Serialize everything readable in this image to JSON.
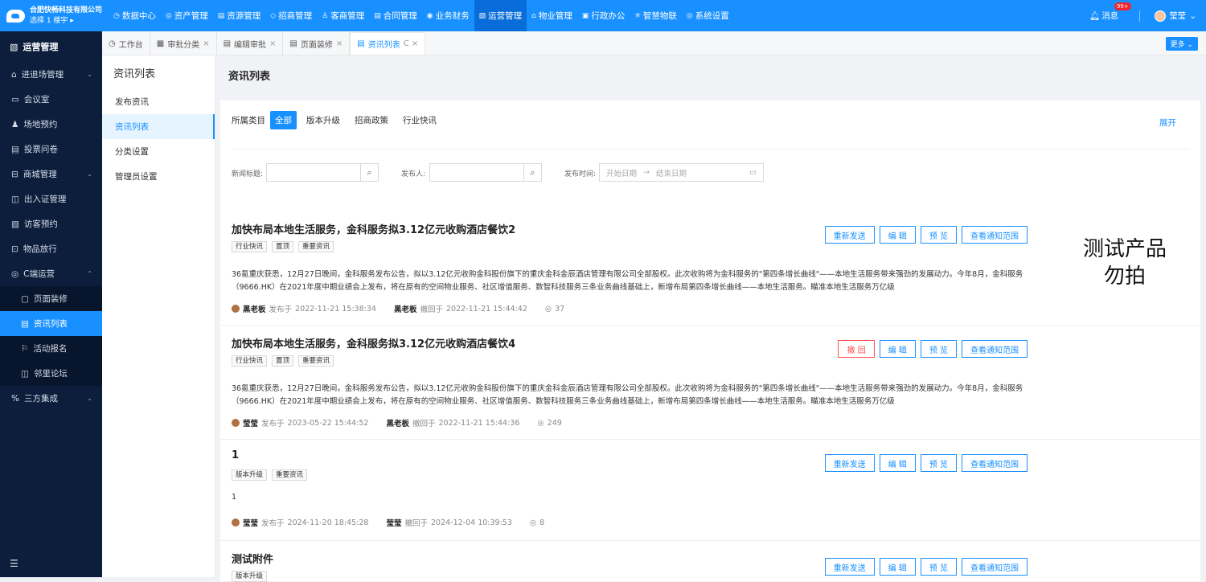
{
  "header": {
    "company": "合肥快畅科技有限公司",
    "location": "选择 1 楼宇 ▸",
    "nav": [
      {
        "icon": "◷",
        "label": "数据中心"
      },
      {
        "icon": "◎",
        "label": "资产管理"
      },
      {
        "icon": "▤",
        "label": "资源管理"
      },
      {
        "icon": "◇",
        "label": "招商管理"
      },
      {
        "icon": "♙",
        "label": "客商管理"
      },
      {
        "icon": "▤",
        "label": "合同管理"
      },
      {
        "icon": "◉",
        "label": "业务财务"
      },
      {
        "icon": "▧",
        "label": "运营管理"
      },
      {
        "icon": "⌂",
        "label": "物业管理"
      },
      {
        "icon": "▣",
        "label": "行政办公"
      },
      {
        "icon": "✳",
        "label": "智慧物联"
      },
      {
        "icon": "◎",
        "label": "系统设置"
      }
    ],
    "messages_label": "消息",
    "messages_badge": "99+",
    "user_name": "莹莹"
  },
  "sidebar": {
    "title": "运营管理",
    "items": [
      {
        "icon": "⌂",
        "label": "进退场管理",
        "chevron": "⌄"
      },
      {
        "icon": "▭",
        "label": "会议室",
        "chevron": ""
      },
      {
        "icon": "♟",
        "label": "场地预约",
        "chevron": ""
      },
      {
        "icon": "▤",
        "label": "投票问卷",
        "chevron": ""
      },
      {
        "icon": "⊟",
        "label": "商城管理",
        "chevron": "⌄"
      },
      {
        "icon": "◫",
        "label": "出入证管理",
        "chevron": ""
      },
      {
        "icon": "▧",
        "label": "访客预约",
        "chevron": ""
      },
      {
        "icon": "⊡",
        "label": "物品放行",
        "chevron": ""
      },
      {
        "icon": "◎",
        "label": "C端运营",
        "chevron": "⌃"
      }
    ],
    "sub_items": [
      {
        "icon": "▢",
        "label": "页面装修"
      },
      {
        "icon": "▤",
        "label": "资讯列表"
      },
      {
        "icon": "⚐",
        "label": "活动报名"
      },
      {
        "icon": "◫",
        "label": "邻里论坛"
      }
    ],
    "last_item": {
      "icon": "%",
      "label": "三方集成",
      "chevron": "⌄"
    },
    "bottom_icon": "☰"
  },
  "tabs": [
    {
      "icon": "◷",
      "label": "工作台",
      "close": ""
    },
    {
      "icon": "▦",
      "label": "审批分类",
      "close": "×"
    },
    {
      "icon": "▤",
      "label": "编辑审批",
      "close": "×"
    },
    {
      "icon": "▤",
      "label": "页面装修",
      "close": "×"
    },
    {
      "icon": "▤",
      "label": "资讯列表",
      "close": "C  ×"
    }
  ],
  "more_label": "更多 ⌄",
  "subnav": {
    "title": "资讯列表",
    "items": [
      "发布资讯",
      "资讯列表",
      "分类设置",
      "管理员设置"
    ]
  },
  "page_title": "资讯列表",
  "filter": {
    "category_label": "所属类目",
    "categories": [
      "全部",
      "版本升级",
      "招商政策",
      "行业快讯"
    ],
    "expand_label": "展开",
    "news_title_label": "新闻标题:",
    "publisher_label": "发布人:",
    "publish_time_label": "发布时间:",
    "start_placeholder": "开始日期",
    "end_placeholder": "结束日期",
    "search_icon": "⌕",
    "date_arrow": "→",
    "calendar_icon": "▭"
  },
  "items": [
    {
      "title": "加快布局本地生活服务，金科服务拟3.12亿元收购酒店餐饮2",
      "tags": [
        "行业快讯",
        "置顶",
        "重要资讯"
      ],
      "body": "36氪重庆获悉，12月27日晚间，金科服务发布公告，拟以3.12亿元收购金科股份旗下的重庆金科金辰酒店管理有限公司全部股权。此次收购将为金科服务的\"第四条增长曲线\"——本地生活服务带来强劲的发展动力。今年8月，金科服务（9666.HK）在2021年度中期业绩会上发布，将在原有的空间物业服务、社区增值服务、数智科技服务三条业务曲线基础上，新增布局第四条增长曲线——本地生活服务。瞄准本地生活服务万亿级",
      "author": "黑老板",
      "published_text": "发布于",
      "published_at": "2022-11-21 15:38:34",
      "revoker": "黑老板",
      "revoked_text": "撤回于",
      "revoked_at": "2022-11-21 15:44:42",
      "views": "37",
      "actions": [
        "重新发送",
        "编 辑",
        "预 览",
        "查看通知范围"
      ]
    },
    {
      "title": "加快布局本地生活服务，金科服务拟3.12亿元收购酒店餐饮4",
      "tags": [
        "行业快讯",
        "置顶",
        "重要资讯"
      ],
      "body": "36氪重庆获悉，12月27日晚间，金科服务发布公告，拟以3.12亿元收购金科股份旗下的重庆金科金辰酒店管理有限公司全部股权。此次收购将为金科服务的\"第四条增长曲线\"——本地生活服务带来强劲的发展动力。今年8月，金科服务（9666.HK）在2021年度中期业绩会上发布，将在原有的空间物业服务、社区增值服务、数智科技服务三条业务曲线基础上，新增布局第四条增长曲线——本地生活服务。瞄准本地生活服务万亿级",
      "author": "莹莹",
      "published_text": "发布于",
      "published_at": "2023-05-22 15:44:52",
      "revoker": "黑老板",
      "revoked_text": "撤回于",
      "revoked_at": "2022-11-21 15:44:36",
      "views": "249",
      "actions": [
        "撤 回",
        "编 辑",
        "预 览",
        "查看通知范围"
      ]
    },
    {
      "title": "1",
      "tags": [
        "版本升级",
        "重要资讯"
      ],
      "body": "1",
      "author": "莹莹",
      "published_text": "发布于",
      "published_at": "2024-11-20 18:45:28",
      "revoker": "莹莹",
      "revoked_text": "撤回于",
      "revoked_at": "2024-12-04 10:39:53",
      "views": "8",
      "actions": [
        "重新发送",
        "编 辑",
        "预 览",
        "查看通知范围"
      ]
    },
    {
      "title": "测试附件",
      "tags": [
        "版本升级"
      ],
      "actions": [
        "重新发送",
        "编 辑",
        "预 览",
        "查看通知范围"
      ]
    }
  ],
  "watermark": [
    "测试产品",
    "勿拍"
  ],
  "eye_icon": "◎"
}
